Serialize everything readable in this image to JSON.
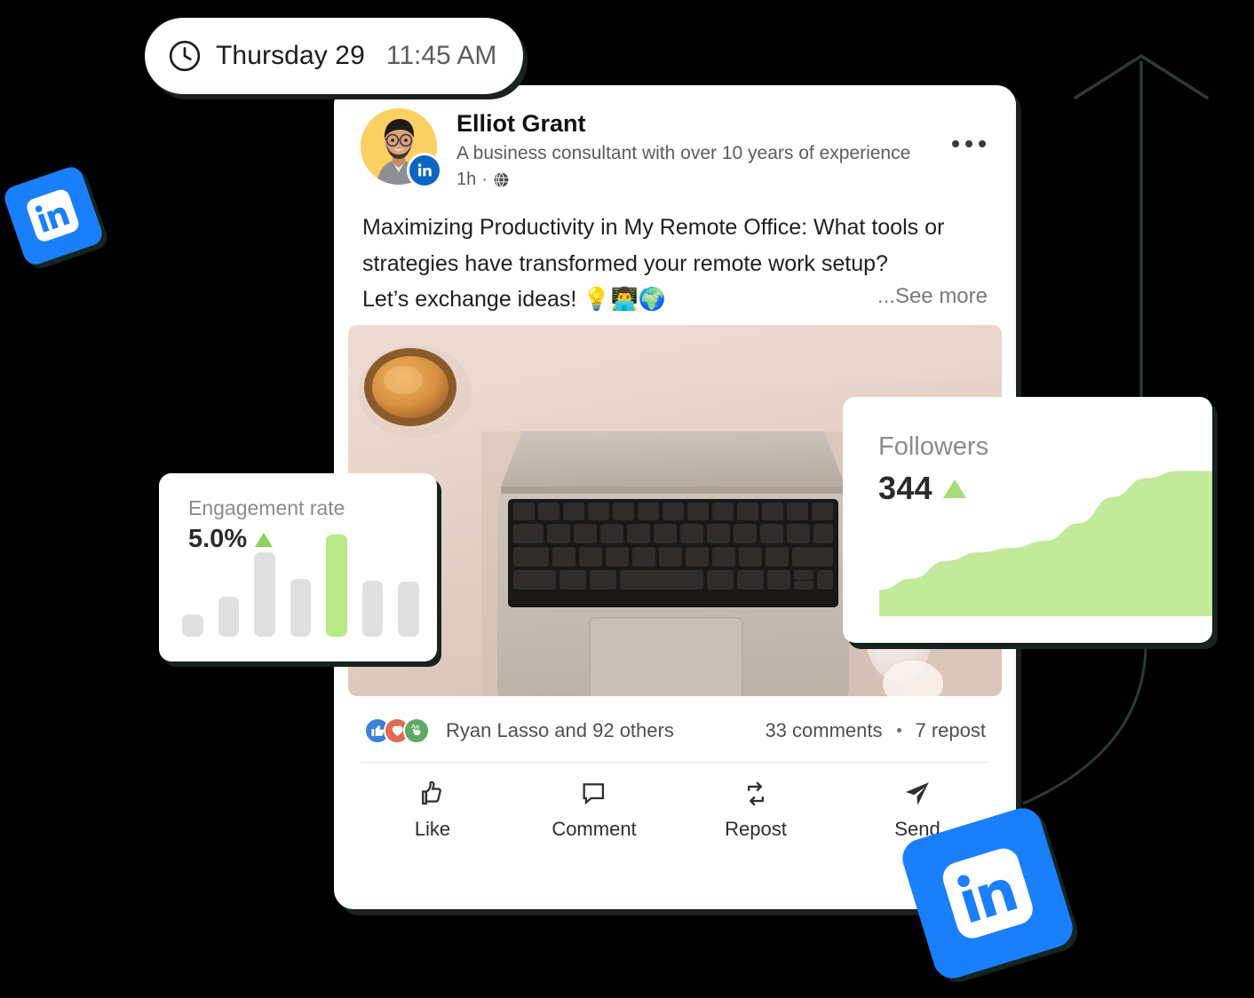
{
  "time_pill": {
    "icon": "clock-icon",
    "day": "Thursday 29",
    "clock": "11:45 AM"
  },
  "post": {
    "author": {
      "name": "Elliot Grant",
      "headline": "A business consultant with over 10 years of experience",
      "time_ago": "1h",
      "separator": "·",
      "audience_icon": "globe-icon",
      "badge_icon": "linkedin-icon",
      "avatar_bg": "#FBD063"
    },
    "more_icon": "more-options-icon",
    "body_lines": [
      "Maximizing Productivity in My Remote Office: What tools or",
      "strategies have transformed your remote work setup?",
      "Let’s exchange ideas! 💡👨‍💻🌍"
    ],
    "see_more": "...See more",
    "image_alt": "laptop-desk-photo",
    "social": {
      "reactions": [
        "like-reaction-icon",
        "love-reaction-icon",
        "clap-reaction-icon"
      ],
      "names": "Ryan Lasso and 92 others",
      "comments": "33 comments",
      "separator": "•",
      "reposts": "7 repost"
    },
    "actions": [
      {
        "icon": "thumbs-up-icon",
        "label": "Like"
      },
      {
        "icon": "comment-bubble-icon",
        "label": "Comment"
      },
      {
        "icon": "repost-icon",
        "label": "Repost"
      },
      {
        "icon": "send-icon",
        "label": "Send"
      }
    ]
  },
  "engagement_card": {
    "label": "Engagement rate",
    "value": "5.0%",
    "trend_icon": "triangle-up-icon",
    "trend_color": "#8FD15C"
  },
  "followers_card": {
    "label": "Followers",
    "value": "344",
    "trend_icon": "triangle-up-icon",
    "trend_color": "#A8DC78"
  },
  "brand": {
    "linkedin_blue": "#1A7FFB",
    "linkedin_badge_blue": "#0A66C2",
    "chart_green": "#C3E99B",
    "bar_grey": "#E0E0E0",
    "bar_green": "#B6E887",
    "shadow": "#16231F"
  },
  "decor": {
    "arrow_icon": "arrow-up-icon",
    "curve_icon": "curve-line-icon",
    "stroke": "#2A3B35"
  },
  "chart_data": [
    {
      "type": "bar",
      "title": "Engagement rate",
      "categories": [
        "1",
        "2",
        "3",
        "4",
        "5",
        "6",
        "7"
      ],
      "values": [
        25,
        45,
        95,
        65,
        115,
        63,
        62
      ],
      "highlight_index": 4,
      "value_label": "5.0%",
      "xlabel": "",
      "ylabel": "",
      "ylim": [
        0,
        128
      ],
      "grid": false,
      "legend": "none",
      "colors": {
        "default": "#E0E0E0",
        "highlight": "#B6E887"
      }
    },
    {
      "type": "area",
      "title": "Followers",
      "x": [
        0,
        1,
        2,
        3,
        4,
        5,
        6,
        7,
        8,
        9,
        10
      ],
      "values": [
        18,
        26,
        38,
        44,
        47,
        52,
        64,
        82,
        95,
        100,
        100
      ],
      "value_label": "344",
      "xlabel": "",
      "ylabel": "",
      "ylim": [
        0,
        110
      ],
      "grid": false,
      "legend": "none",
      "colors": {
        "area": "#C3E99B"
      }
    }
  ]
}
